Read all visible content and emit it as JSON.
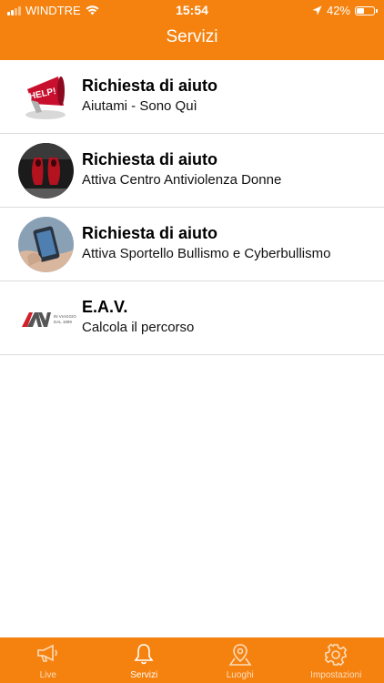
{
  "status_bar": {
    "carrier": "WINDTRE",
    "time": "15:54",
    "battery": "42%",
    "icons": [
      "signal-icon",
      "wifi-icon",
      "location-arrow-icon",
      "battery-icon"
    ]
  },
  "header": {
    "title": "Servizi"
  },
  "services": [
    {
      "title": "Richiesta di aiuto",
      "subtitle": "Aiutami - Sono Quì",
      "icon": "megaphone-help-icon",
      "badge": "HELP!"
    },
    {
      "title": "Richiesta di aiuto",
      "subtitle": "Attiva Centro Antiviolenza Donne",
      "icon": "red-shoes-icon"
    },
    {
      "title": "Richiesta di aiuto",
      "subtitle": "Attiva Sportello Bullismo e Cyberbullismo",
      "icon": "phone-hand-icon"
    },
    {
      "title": "E.A.V.",
      "subtitle": "Calcola il percorso",
      "icon": "eav-logo-icon",
      "logo_text": "EAV",
      "logo_tagline": "IN VIAGGIO DAL 1899"
    }
  ],
  "tabbar": {
    "tabs": [
      {
        "label": "Live",
        "icon": "megaphone-icon",
        "active": false
      },
      {
        "label": "Servizi",
        "icon": "bell-icon",
        "active": true
      },
      {
        "label": "Luoghi",
        "icon": "map-pin-icon",
        "active": false
      },
      {
        "label": "Impostazioni",
        "icon": "gear-icon",
        "active": false
      }
    ]
  },
  "colors": {
    "accent": "#f5820f",
    "divider": "#dcdcdc",
    "logo_red": "#d11f2a"
  }
}
